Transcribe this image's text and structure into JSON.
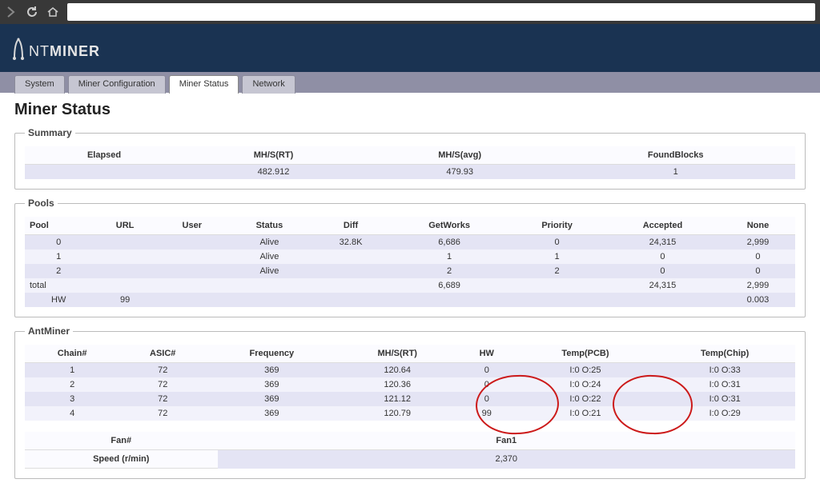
{
  "tabs": [
    "System",
    "Miner Configuration",
    "Miner Status",
    "Network"
  ],
  "active_tab": "Miner Status",
  "page_heading": "Miner Status",
  "summary": {
    "legend": "Summary",
    "headers": [
      "Elapsed",
      "MH/S(RT)",
      "MH/S(avg)",
      "FoundBlocks"
    ],
    "values": [
      "",
      "482.912",
      "479.93",
      "1"
    ]
  },
  "pools": {
    "legend": "Pools",
    "headers": [
      "Pool",
      "URL",
      "User",
      "Status",
      "Diff",
      "GetWorks",
      "Priority",
      "Accepted",
      "None"
    ],
    "rows": [
      [
        "0",
        "",
        "",
        "Alive",
        "32.8K",
        "6,686",
        "0",
        "24,315",
        "2,999"
      ],
      [
        "1",
        "",
        "",
        "Alive",
        "",
        "1",
        "1",
        "0",
        "0"
      ],
      [
        "2",
        "",
        "",
        "Alive",
        "",
        "2",
        "2",
        "0",
        "0"
      ],
      [
        "total",
        "",
        "",
        "",
        "",
        "6,689",
        "",
        "24,315",
        "2,999"
      ],
      [
        "HW",
        "99",
        "",
        "",
        "",
        "",
        "",
        "",
        "0.003"
      ]
    ]
  },
  "antminer": {
    "legend": "AntMiner",
    "headers": [
      "Chain#",
      "ASIC#",
      "Frequency",
      "MH/S(RT)",
      "HW",
      "Temp(PCB)",
      "Temp(Chip)"
    ],
    "rows": [
      [
        "1",
        "72",
        "369",
        "120.64",
        "0",
        "I:0 O:25",
        "I:0 O:33"
      ],
      [
        "2",
        "72",
        "369",
        "120.36",
        "0",
        "I:0 O:24",
        "I:0 O:31"
      ],
      [
        "3",
        "72",
        "369",
        "121.12",
        "0",
        "I:0 O:22",
        "I:0 O:31"
      ],
      [
        "4",
        "72",
        "369",
        "120.79",
        "99",
        "I:0 O:21",
        "I:0 O:29"
      ]
    ],
    "fan": {
      "label_num": "Fan#",
      "label_speed": "Speed (r/min)",
      "col": "Fan1",
      "speed": "2,370"
    }
  }
}
